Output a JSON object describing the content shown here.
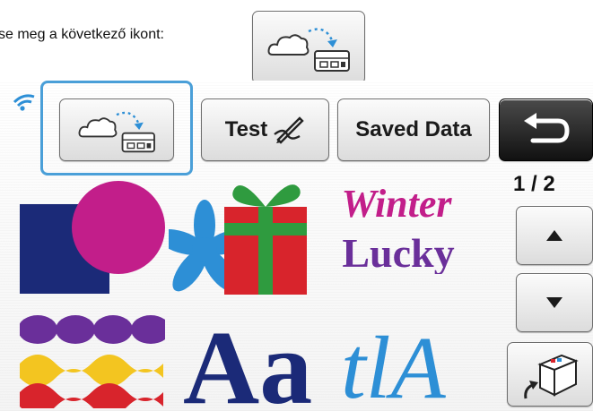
{
  "instruction": {
    "text": "se meg a következő ikont:"
  },
  "toolbar": {
    "test_label": "Test",
    "saved_label": "Saved Data"
  },
  "pagination": {
    "indicator": "1 / 2"
  },
  "thumbnails": {
    "winter_line1": "Winter",
    "winter_line2": "Lucky",
    "font_sample": "Aa",
    "script_sample": "tlA"
  },
  "icons": {
    "cloud_transfer": "cloud-to-machine-icon",
    "test": "cutting-pen-icon",
    "back": "return-arrow-icon",
    "up": "triangle-up-icon",
    "down": "triangle-down-icon",
    "storage": "storage-box-icon",
    "wifi": "wifi-icon"
  },
  "colors": {
    "highlight": "#4a9fd8",
    "navy": "#1b2a78",
    "magenta": "#c21e8a",
    "purple": "#6a2f9a",
    "blue": "#2d8fd6",
    "red": "#d8242c",
    "green": "#2f9b3f",
    "yellow": "#f3c520"
  }
}
